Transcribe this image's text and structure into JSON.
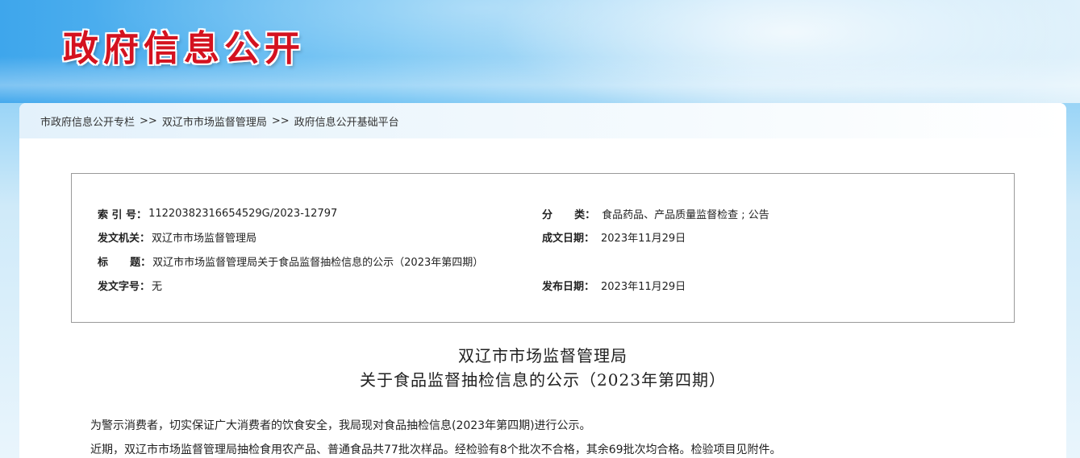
{
  "banner": {
    "title": "政府信息公开"
  },
  "breadcrumb": {
    "items": [
      "市政府信息公开专栏",
      "双辽市市场监督管理局",
      "政府信息公开基础平台"
    ],
    "separator": ">>"
  },
  "meta": {
    "index_label": "索 引 号：",
    "index_value": "11220382316654529G/2023-12797",
    "category_label": "分      类：",
    "category_value": "食品药品、产品质量监督检查 ; 公告",
    "issuer_label": "发文机关：",
    "issuer_value": "双辽市市场监督管理局",
    "created_label": "成文日期：",
    "created_value": "2023年11月29日",
    "title_label": "标      题：",
    "title_value": "双辽市市场监督管理局关于食品监督抽检信息的公示（2023年第四期）",
    "docno_label": "发文字号：",
    "docno_value": "无",
    "published_label": "发布日期：",
    "published_value": "2023年11月29日"
  },
  "article": {
    "title_line1": "双辽市市场监督管理局",
    "title_line2": "关于食品监督抽检信息的公示（2023年第四期）",
    "paragraph1": "为警示消费者，切实保证广大消费者的饮食安全，我局现对食品抽检信息(2023年第四期)进行公示。",
    "paragraph2": "近期，双辽市市场监督管理局抽检食用农产品、普通食品共77批次样品。经检验有8个批次不合格，其余69批次均合格。检验项目见附件。"
  },
  "colors": {
    "banner_title": "#d4121f",
    "link": "#333333"
  }
}
